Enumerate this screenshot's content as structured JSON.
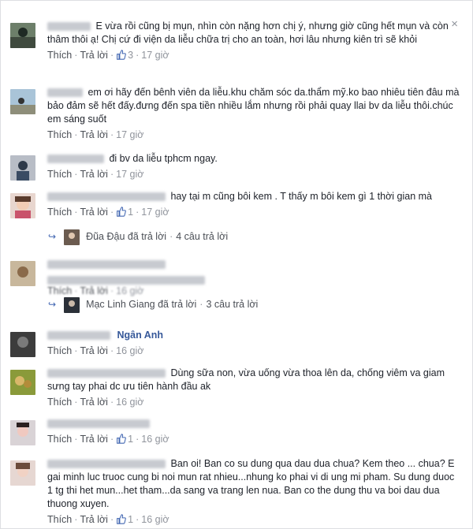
{
  "close_label": "×",
  "comments": [
    {
      "author_blur": "Ngọc Trân",
      "text": "E vừa rồi cũng bị mụn, nhìn còn nặng hơn chị ý, nhưng giờ cũng hết mụn và còn thâm thôi ạ! Chị cứ đi viện da liễu chữa trị cho an toàn, hơi lâu nhưng kiên trì sẽ khỏi",
      "like": "Thích",
      "reply": "Trả lời",
      "likes": "3",
      "time": "17 giờ"
    },
    {
      "author_blur": "Minh Hà",
      "text": "em ơi hãy đến bênh viên da liễu.khu chăm sóc da.thẩm mỹ.ko bao nhiêu tiên đâu mà bảo đảm sẽ hết đấy.đưng đến spa tiền nhiều lắm nhưng rồi phải quay llai bv da liễu thôi.chúc em sáng suốt",
      "like": "Thích",
      "reply": "Trả lời",
      "likes": "",
      "time": "17 giờ"
    },
    {
      "author_blur": "Thu Hằng",
      "text": "đi bv da liễu tphcm ngay.",
      "like": "Thích",
      "reply": "Trả lời",
      "likes": "",
      "time": "17 giờ"
    },
    {
      "author_blur": "Thanh Hương Lan",
      "text": "hay tại m cũng bôi kem . T thấy m bôi kem gì 1 thời gian mà",
      "like": "Thích",
      "reply": "Trả lời",
      "likes": "1",
      "time": "17 giờ",
      "reply_by": "Đũa Đậu đã trả lời",
      "reply_count": "4 câu trả lời"
    },
    {
      "author_blur": "Nguyễn Thị",
      "text": "",
      "like": "Thích",
      "reply": "Trả lời",
      "likes": "",
      "time": "16 giờ",
      "reply_by": "Mạc Linh Giang đã trả lời",
      "reply_count": "3 câu trả lời"
    },
    {
      "author_blur": "Phạm",
      "author_tail": "Ngân Anh",
      "text": "",
      "like": "Thích",
      "reply": "Trả lời",
      "likes": "",
      "time": "16 giờ"
    },
    {
      "author_blur": "Nguyễn Hoàng",
      "text": "Dùng sữa non, vừa uống vừa thoa lên da, chống viêm va giam sưng tay phai dc ưu tiên hành đầu ak",
      "like": "Thích",
      "reply": "Trả lời",
      "likes": "",
      "time": "16 giờ"
    },
    {
      "author_blur": "Trần Ngọc",
      "text": "",
      "like": "Thích",
      "reply": "Trả lời",
      "likes": "1",
      "time": "16 giờ"
    },
    {
      "author_blur": "Hoàng Thu Thủy",
      "text": "Ban oi! Ban co su dung qua dau dua chua? Kem theo ... chua? E gai minh luc truoc cung bi noi mun rat nhieu...nhung ko phai vi di ung mi pham. Su dung duoc 1 tg thi het mun...het tham...da sang va trang len nua. Ban co the dung thu va boi dau dua thuong xuyen.",
      "like": "Thích",
      "reply": "Trả lời",
      "likes": "1",
      "time": "16 giờ"
    }
  ],
  "colors": {
    "link": "#365899",
    "meta": "#90949c",
    "border": "#dddfe2",
    "like_blue": "#4267b2"
  }
}
